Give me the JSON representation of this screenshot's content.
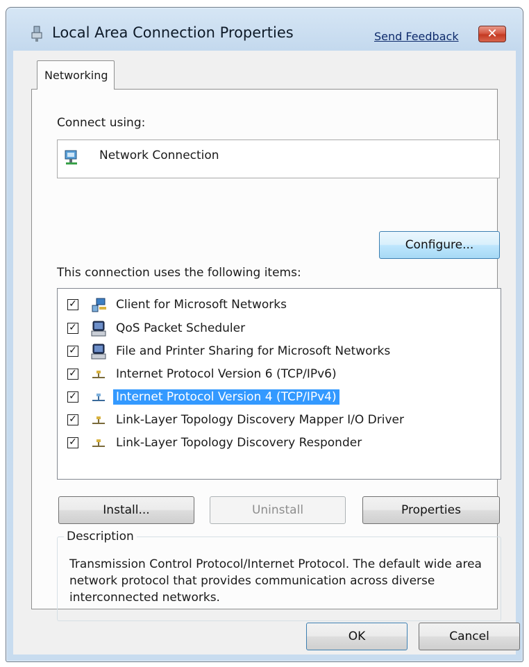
{
  "window": {
    "title": "Local Area Connection Properties",
    "feedback_link": "Send Feedback",
    "close_icon": "close-icon"
  },
  "tabs": [
    {
      "label": "Networking",
      "selected": true
    }
  ],
  "connect_using": {
    "label": "Connect using:",
    "adapter_name": "Network Connection",
    "configure_label": "Configure..."
  },
  "items_section": {
    "label": "This connection uses the following items:",
    "items": [
      {
        "label": "Client for Microsoft Networks",
        "checked": true,
        "icon": "network-client-icon",
        "selected": false
      },
      {
        "label": "QoS Packet Scheduler",
        "checked": true,
        "icon": "service-icon",
        "selected": false
      },
      {
        "label": "File and Printer Sharing for Microsoft Networks",
        "checked": true,
        "icon": "service-icon",
        "selected": false
      },
      {
        "label": "Internet Protocol Version 6 (TCP/IPv6)",
        "checked": true,
        "icon": "protocol-icon",
        "selected": false
      },
      {
        "label": "Internet Protocol Version 4 (TCP/IPv4)",
        "checked": true,
        "icon": "protocol-icon",
        "selected": true
      },
      {
        "label": "Link-Layer Topology Discovery Mapper I/O Driver",
        "checked": true,
        "icon": "protocol-icon",
        "selected": false
      },
      {
        "label": "Link-Layer Topology Discovery Responder",
        "checked": true,
        "icon": "protocol-icon",
        "selected": false
      }
    ]
  },
  "actions": {
    "install": "Install...",
    "uninstall": "Uninstall",
    "properties": "Properties"
  },
  "description": {
    "title": "Description",
    "text": "Transmission Control Protocol/Internet Protocol. The default wide area network protocol that provides communication across diverse interconnected networks."
  },
  "footer": {
    "ok": "OK",
    "cancel": "Cancel"
  },
  "colors": {
    "selection": "#3399ff",
    "title_gradient": "#c4d9ee",
    "close_button": "#c43a22"
  }
}
